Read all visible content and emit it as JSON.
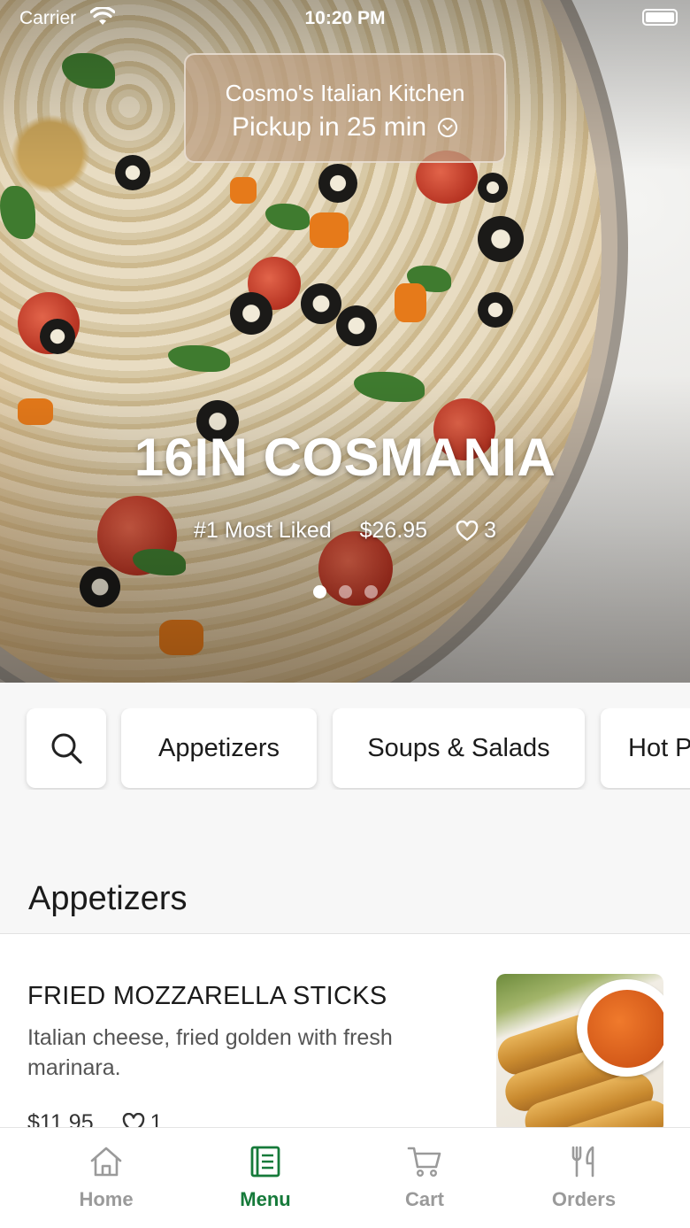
{
  "status_bar": {
    "carrier": "Carrier",
    "time": "10:20 PM"
  },
  "store": {
    "name": "Cosmo's Italian Kitchen",
    "pickup": "Pickup in 25 min"
  },
  "featured": {
    "title": "16IN COSMANIA",
    "badge": "#1 Most Liked",
    "price": "$26.95",
    "likes": "3",
    "carousel_pages": 3,
    "active_page": 1
  },
  "categories": [
    {
      "label": "Appetizers"
    },
    {
      "label": "Soups & Salads"
    },
    {
      "label": "Hot Pizza"
    }
  ],
  "section": {
    "title": "Appetizers"
  },
  "items": [
    {
      "name": "FRIED MOZZARELLA STICKS",
      "description": "Italian cheese, fried golden with fresh marinara.",
      "price": "$11.95",
      "likes": "1"
    }
  ],
  "tabs": [
    {
      "label": "Home",
      "icon": "home-icon",
      "active": false
    },
    {
      "label": "Menu",
      "icon": "menu-icon",
      "active": true
    },
    {
      "label": "Cart",
      "icon": "cart-icon",
      "active": false
    },
    {
      "label": "Orders",
      "icon": "orders-icon",
      "active": false
    }
  ],
  "colors": {
    "accent": "#167a3a",
    "inactive_tab": "#9a9a9a"
  }
}
